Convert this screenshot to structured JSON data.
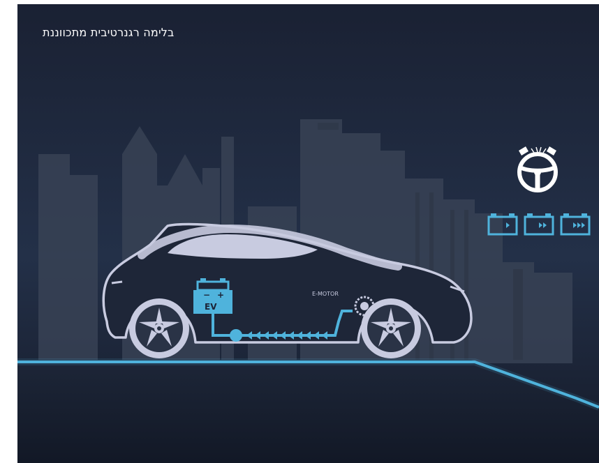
{
  "caption": "בלימה רגנרטיבית מתכווננת",
  "diagram": {
    "battery_label": "EV",
    "battery_minus": "−",
    "battery_plus": "+",
    "motor_label": "E-MOTOR"
  },
  "icons": [
    "steering-wheel-paddle-icon",
    "regen-level-1-icon",
    "regen-level-2-icon",
    "regen-level-3-icon"
  ],
  "colors": {
    "background": "#1c2437",
    "accent": "#4fb3dc",
    "car_outline": "#c8cbe0",
    "city": "#3a4457"
  }
}
